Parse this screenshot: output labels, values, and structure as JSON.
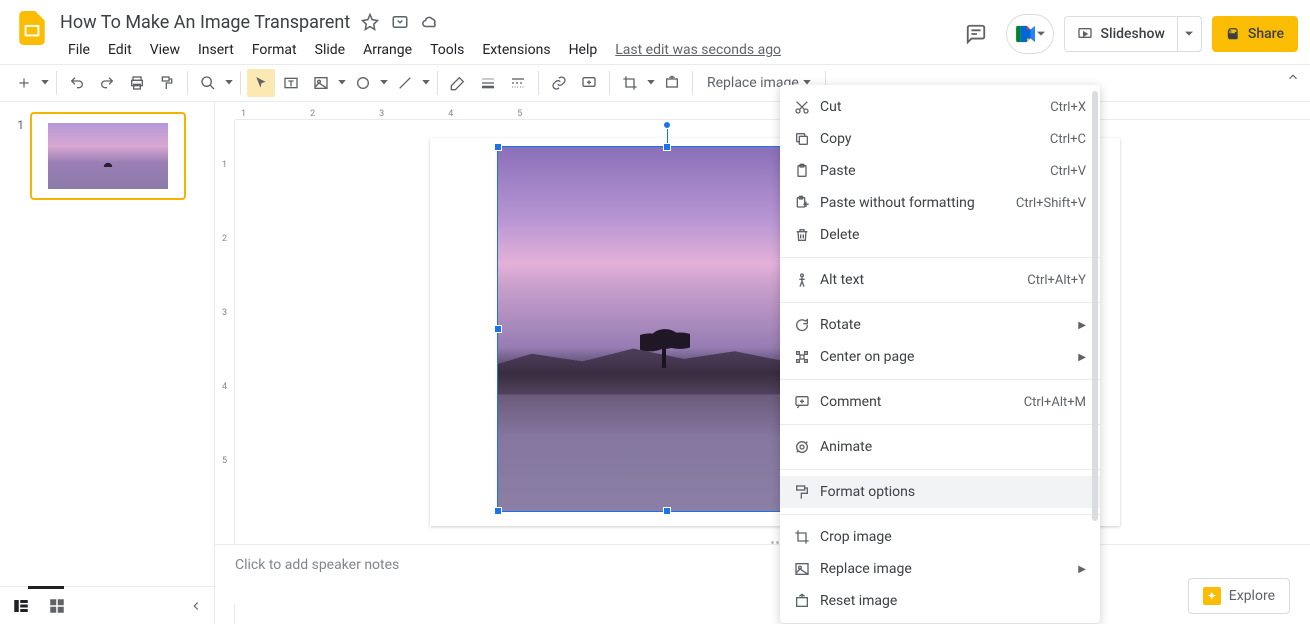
{
  "doc": {
    "title": "How To Make An Image Transparent"
  },
  "menus": {
    "file": "File",
    "edit": "Edit",
    "view": "View",
    "insert": "Insert",
    "format": "Format",
    "slide": "Slide",
    "arrange": "Arrange",
    "tools": "Tools",
    "extensions": "Extensions",
    "help": "Help",
    "last_edit": "Last edit was seconds ago"
  },
  "header_buttons": {
    "slideshow": "Slideshow",
    "share": "Share"
  },
  "toolbar": {
    "replace_image": "Replace image"
  },
  "ruler_h": [
    "1",
    "2",
    "3",
    "4",
    "5"
  ],
  "ruler_v": [
    "1",
    "2",
    "3",
    "4",
    "5"
  ],
  "filmstrip": {
    "slides": [
      {
        "num": "1"
      }
    ]
  },
  "notes": {
    "placeholder": "Click to add speaker notes"
  },
  "explore": {
    "label": "Explore"
  },
  "context_menu": {
    "items": [
      {
        "icon": "cut",
        "label": "Cut",
        "shortcut": "Ctrl+X"
      },
      {
        "icon": "copy",
        "label": "Copy",
        "shortcut": "Ctrl+C"
      },
      {
        "icon": "paste",
        "label": "Paste",
        "shortcut": "Ctrl+V"
      },
      {
        "icon": "paste-plain",
        "label": "Paste without formatting",
        "shortcut": "Ctrl+Shift+V"
      },
      {
        "icon": "delete",
        "label": "Delete",
        "shortcut": ""
      },
      {
        "sep": true
      },
      {
        "icon": "alt-text",
        "label": "Alt text",
        "shortcut": "Ctrl+Alt+Y"
      },
      {
        "sep": true
      },
      {
        "icon": "rotate",
        "label": "Rotate",
        "submenu": true
      },
      {
        "icon": "center",
        "label": "Center on page",
        "submenu": true
      },
      {
        "sep": true
      },
      {
        "icon": "comment",
        "label": "Comment",
        "shortcut": "Ctrl+Alt+M"
      },
      {
        "sep": true
      },
      {
        "icon": "animate",
        "label": "Animate",
        "shortcut": ""
      },
      {
        "sep": true
      },
      {
        "icon": "format-options",
        "label": "Format options",
        "highlight": true
      },
      {
        "sep": true
      },
      {
        "icon": "crop",
        "label": "Crop image"
      },
      {
        "icon": "replace-img",
        "label": "Replace image",
        "submenu": true
      },
      {
        "icon": "reset-img",
        "label": "Reset image"
      }
    ]
  }
}
